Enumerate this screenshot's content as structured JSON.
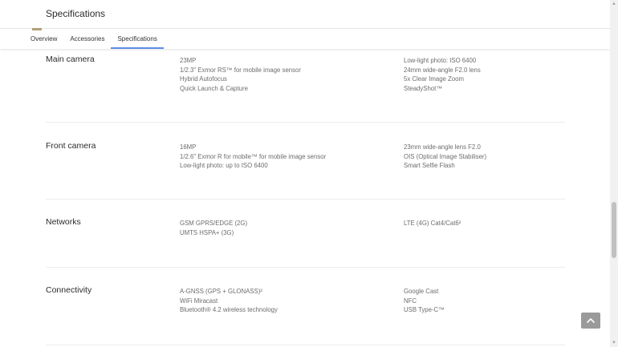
{
  "header": {
    "title": "Specifications"
  },
  "tabs": [
    {
      "label": "Overview"
    },
    {
      "label": "Accessories"
    },
    {
      "label": "Specifications",
      "active": true
    }
  ],
  "sections": {
    "main_camera": {
      "title": "Main camera",
      "left": [
        "23MP",
        "1/2.3\" Exmor RS™ for mobile image sensor",
        "Hybrid Autofocus",
        "Quick Launch & Capture"
      ],
      "right": [
        "Low-light photo: ISO 6400",
        "24mm wide-angle F2.0 lens",
        "5x Clear Image Zoom",
        "SteadyShot™"
      ]
    },
    "front_camera": {
      "title": "Front camera",
      "left": [
        "16MP",
        "1/2.6\" Exmor R for mobile™ for mobile image sensor",
        "Low-light photo: up to ISO 6400"
      ],
      "right": [
        "23mm wide-angle lens F2.0",
        "OIS (Optical Image Stabiliser)",
        "Smart Selfie Flash"
      ]
    },
    "networks": {
      "title": "Networks",
      "left": [
        "GSM GPRS/EDGE (2G)",
        "UMTS HSPA+ (3G)"
      ],
      "right": [
        "LTE (4G) Cat4/Cat6²"
      ]
    },
    "connectivity": {
      "title": "Connectivity",
      "left": [
        "A-GNSS (GPS + GLONASS)²",
        "WiFi Miracast",
        "Bluetooth® 4.2 wireless technology"
      ],
      "right": [
        "Google Cast",
        "NFC",
        "USB Type-C™"
      ]
    }
  },
  "icons": {
    "back_to_top": "chevron-up-icon"
  },
  "colors": {
    "tab_active_underline": "#5b8ee6",
    "back_to_top_bg": "#9a9a9a"
  }
}
